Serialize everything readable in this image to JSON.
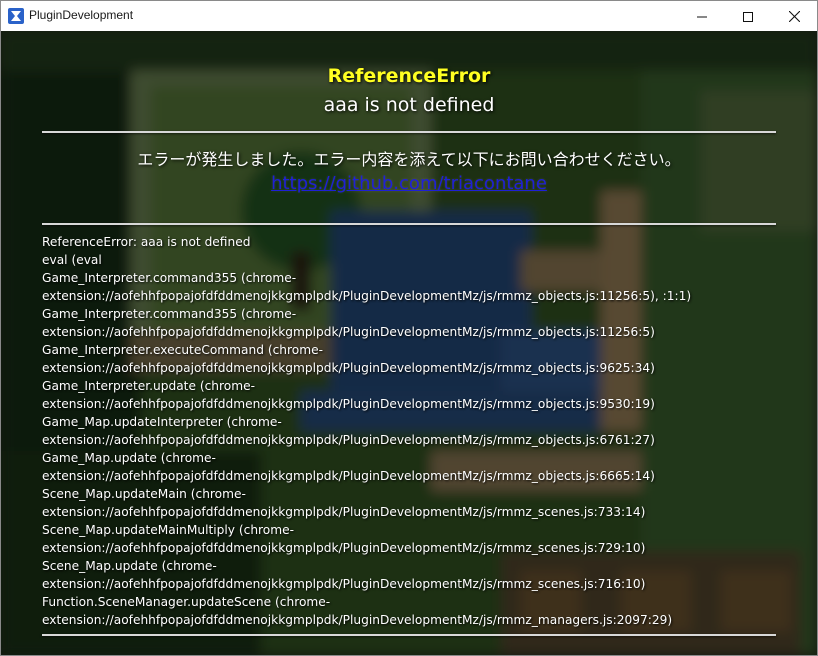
{
  "window": {
    "title": "PluginDevelopment",
    "minimize_label": "minimize",
    "maximize_label": "maximize",
    "close_label": "close"
  },
  "error": {
    "name": "ReferenceError",
    "message": "aaa is not defined",
    "help_text": "エラーが発生しました。エラー内容を添えて以下にお問い合わせください。",
    "link": "https://github.com/triacontane"
  },
  "stack": [
    "ReferenceError: aaa is not defined",
    "eval (eval",
    "Game_Interpreter.command355 (chrome-",
    "extension://aofehhfpopajofdfddmenojkkgmplpdk/PluginDevelopmentMz/js/rmmz_objects.js:11256:5), :1:1)",
    "Game_Interpreter.command355 (chrome-",
    "extension://aofehhfpopajofdfddmenojkkgmplpdk/PluginDevelopmentMz/js/rmmz_objects.js:11256:5)",
    "Game_Interpreter.executeCommand (chrome-",
    "extension://aofehhfpopajofdfddmenojkkgmplpdk/PluginDevelopmentMz/js/rmmz_objects.js:9625:34)",
    "Game_Interpreter.update (chrome-",
    "extension://aofehhfpopajofdfddmenojkkgmplpdk/PluginDevelopmentMz/js/rmmz_objects.js:9530:19)",
    "Game_Map.updateInterpreter (chrome-",
    "extension://aofehhfpopajofdfddmenojkkgmplpdk/PluginDevelopmentMz/js/rmmz_objects.js:6761:27)",
    "Game_Map.update (chrome-",
    "extension://aofehhfpopajofdfddmenojkkgmplpdk/PluginDevelopmentMz/js/rmmz_objects.js:6665:14)",
    "Scene_Map.updateMain (chrome-",
    "extension://aofehhfpopajofdfddmenojkkgmplpdk/PluginDevelopmentMz/js/rmmz_scenes.js:733:14)",
    "Scene_Map.updateMainMultiply (chrome-",
    "extension://aofehhfpopajofdfddmenojkkgmplpdk/PluginDevelopmentMz/js/rmmz_scenes.js:729:10)",
    "Scene_Map.update (chrome-",
    "extension://aofehhfpopajofdfddmenojkkgmplpdk/PluginDevelopmentMz/js/rmmz_scenes.js:716:10)",
    "Function.SceneManager.updateScene (chrome-",
    "extension://aofehhfpopajofdfddmenojkkgmplpdk/PluginDevelopmentMz/js/rmmz_managers.js:2097:29)"
  ],
  "icons": {
    "app": "app-icon",
    "minimize": "minimize-icon",
    "maximize": "maximize-icon",
    "close": "close-icon"
  },
  "colors": {
    "error_title": "#ffff22",
    "link": "#1f1fd6",
    "text": "#ffffff"
  }
}
